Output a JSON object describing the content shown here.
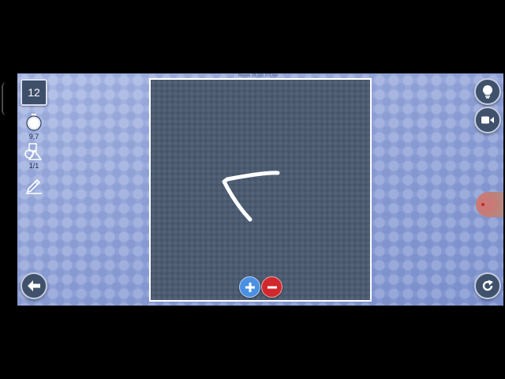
{
  "level": {
    "number": "12"
  },
  "timer": {
    "icon": "stopwatch-icon",
    "value": "9,7"
  },
  "shapes": {
    "icon": "shapes-icon",
    "value": "1/1"
  },
  "pencil": {
    "icon": "pencil-icon"
  },
  "board": {
    "title": "Resolu 38,165,371 fun",
    "stroke_color": "#ffffff"
  },
  "controls": {
    "hint": {
      "icon": "lightbulb-icon"
    },
    "video": {
      "icon": "video-camera-icon"
    },
    "back": {
      "icon": "arrow-left-icon"
    },
    "restart": {
      "icon": "restart-icon"
    },
    "zoom_in": {
      "icon": "plus-icon",
      "color": "#4a90e2"
    },
    "zoom_out": {
      "icon": "minus-icon",
      "color": "#d0282d"
    }
  },
  "colors": {
    "background": "#8fa3d8",
    "board": "#4a5a70",
    "button": "#3f516b"
  }
}
